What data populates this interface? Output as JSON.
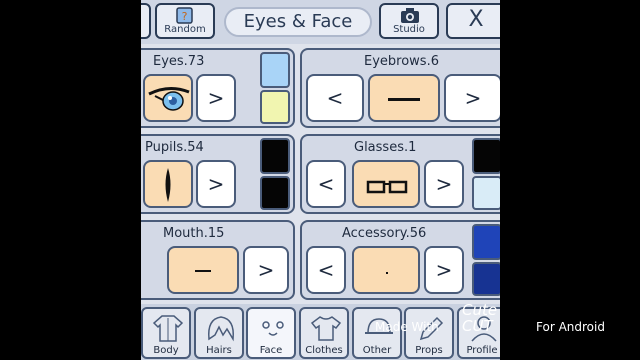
{
  "topbar": {
    "random_label": "Random",
    "title": "Eyes & Face",
    "studio_label": "Studio",
    "close_label": "X"
  },
  "panels": {
    "eyes": {
      "label": "Eyes.73",
      "next": ">"
    },
    "eyebrows": {
      "label": "Eyebrows.6",
      "prev": "<",
      "next": ">"
    },
    "pupils": {
      "label": "Pupils.54",
      "next": ">"
    },
    "glasses": {
      "label": "Glasses.1",
      "prev": "<",
      "next": ">"
    },
    "mouth": {
      "label": "Mouth.15",
      "next": ">"
    },
    "accessory": {
      "label": "Accessory.56",
      "prev": "<",
      "next": ">"
    }
  },
  "colors": {
    "eyes_top": "#a9d4f7",
    "eyes_bottom": "#f1f5b0",
    "pupils_top": "#050505",
    "pupils_bottom": "#050505",
    "glasses_top": "#050505",
    "glasses_bottom": "#d9ecf7",
    "accessory_top": "#1f44b8",
    "accessory_bottom": "#173392"
  },
  "tabs": [
    {
      "label": "Body",
      "icon": "shirt-icon"
    },
    {
      "label": "Hairs",
      "icon": "hair-icon"
    },
    {
      "label": "Face",
      "icon": "face-icon"
    },
    {
      "label": "Clothes",
      "icon": "tshirt-icon"
    },
    {
      "label": "Other",
      "icon": "cap-icon"
    },
    {
      "label": "Props",
      "icon": "pencil-icon"
    },
    {
      "label": "Profile",
      "icon": "profile-icon"
    }
  ],
  "watermark": {
    "made_with": "Made With",
    "brand": "Cute CUT",
    "platform": "For Android"
  }
}
